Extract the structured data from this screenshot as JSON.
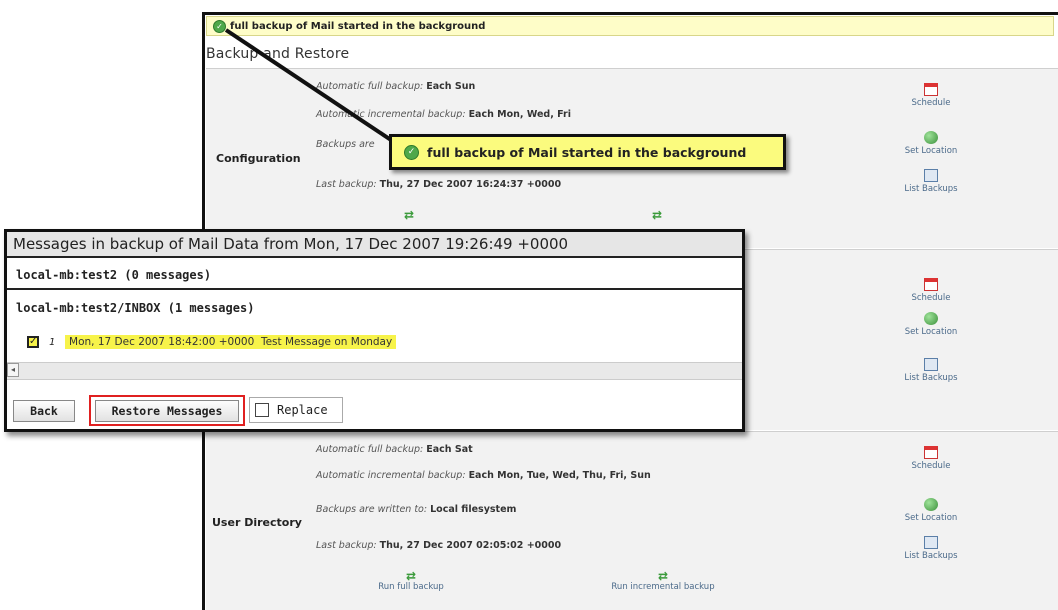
{
  "banner": {
    "text": "full backup of Mail started in the background"
  },
  "section_title": "Backup and Restore",
  "callout": {
    "text": "full backup of Mail started in the background"
  },
  "rows": [
    {
      "label": "Configuration",
      "full_label": "Automatic full backup:",
      "full_value": "Each Sun",
      "inc_label": "Automatic incremental backup:",
      "inc_value": "Each Mon, Wed, Fri",
      "loc_label": "Backups are",
      "last_label": "Last backup:",
      "last_value": "Thu, 27 Dec 2007 16:24:37 +0000"
    },
    {
      "label": "User Directory",
      "full_label": "Automatic full backup:",
      "full_value": "Each Sat",
      "inc_label": "Automatic incremental backup:",
      "inc_value": "Each Mon, Tue, Wed, Thu, Fri, Sun",
      "loc_label": "Backups are written to:",
      "loc_value": "Local filesystem",
      "last_label": "Last backup:",
      "last_value": "Thu, 27 Dec 2007 02:05:02 +0000"
    }
  ],
  "actions": {
    "schedule": "Schedule",
    "set_location": "Set Location",
    "list_backups": "List Backups"
  },
  "run": {
    "full": "Run full backup",
    "incremental": "Run incremental backup"
  },
  "dialog": {
    "title": "Messages in backup of Mail Data from Mon, 17 Dec 2007 19:26:49 +0000",
    "folder1": "local-mb:test2 (0 messages)",
    "folder2": "local-mb:test2/INBOX (1 messages)",
    "message": {
      "num": "1",
      "date": "Mon, 17 Dec 2007 18:42:00 +0000",
      "subject": "Test Message on Monday",
      "checked": true
    },
    "back": "Back",
    "restore": "Restore Messages",
    "replace": "Replace"
  },
  "colors": {
    "highlight": "#fbfb7e",
    "link": "#4b6a8a",
    "restore_outline": "#e02020"
  }
}
